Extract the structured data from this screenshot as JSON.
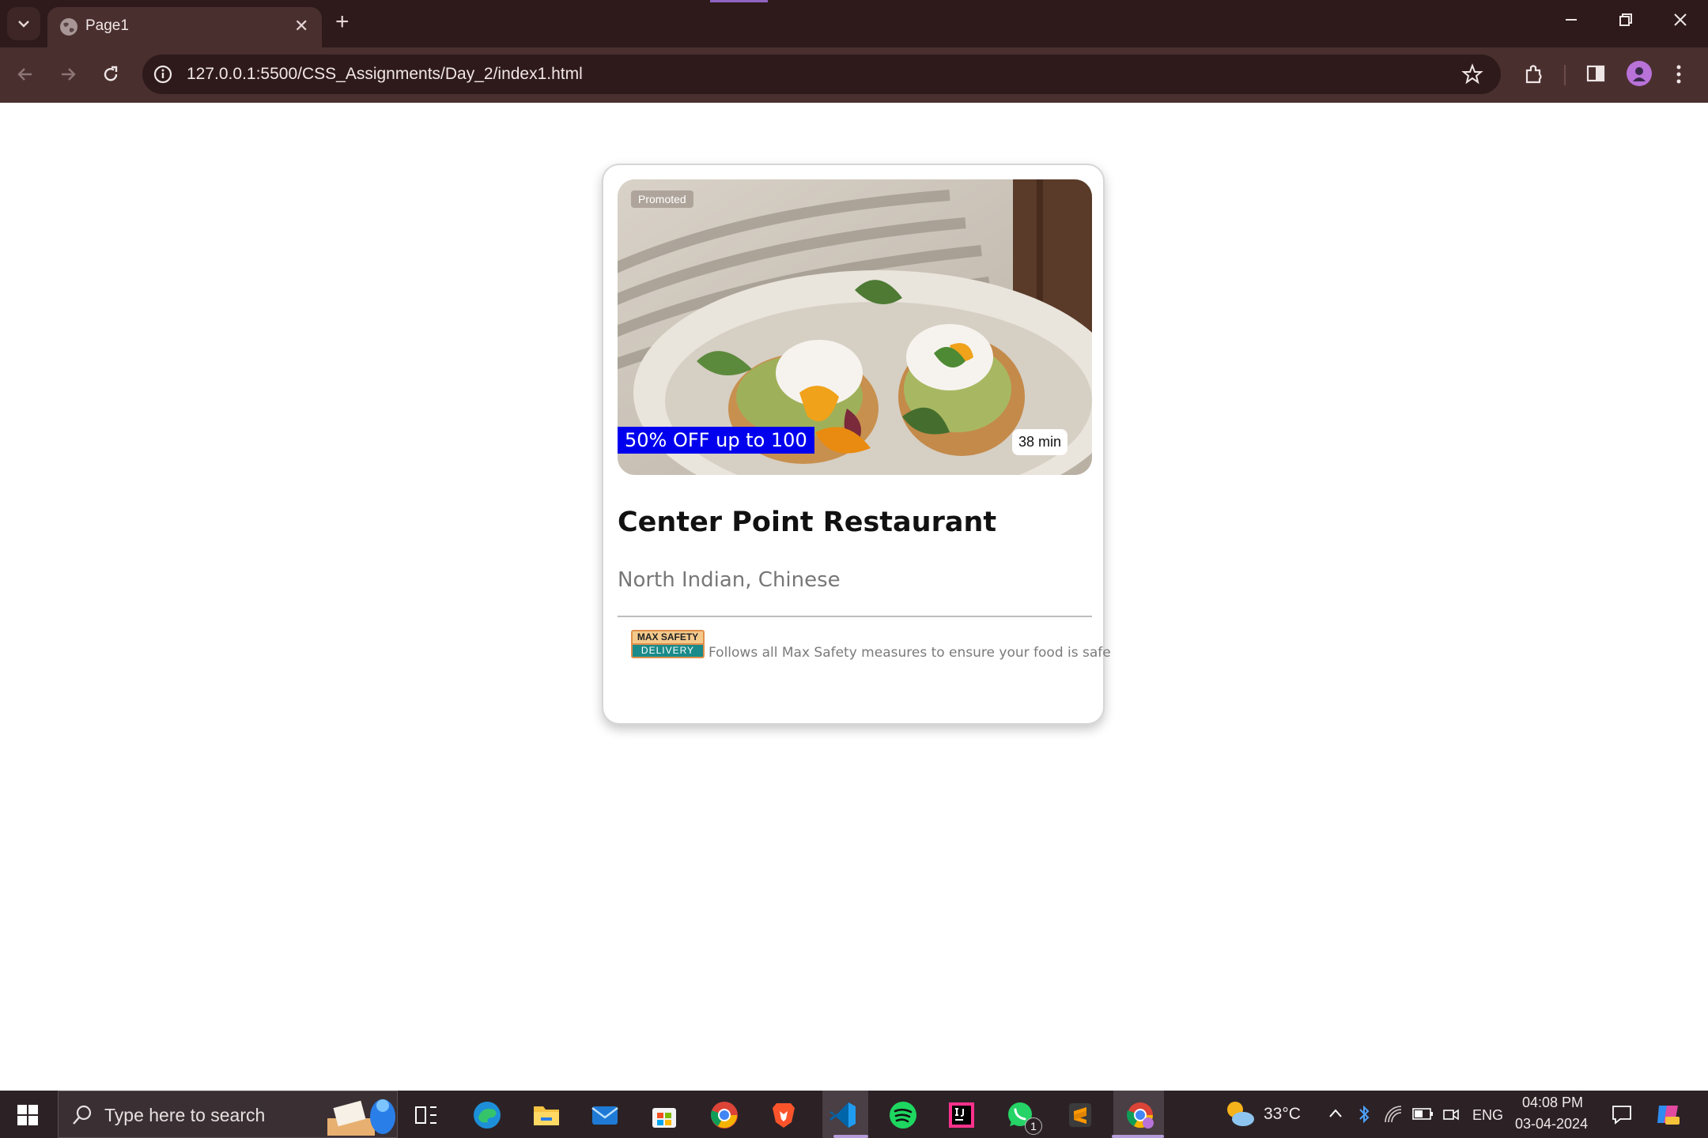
{
  "browser": {
    "tab_title": "Page1",
    "url": "127.0.0.1:5500/CSS_Assignments/Day_2/index1.html",
    "new_tab_label": "+",
    "close_tab_label": "✕"
  },
  "card": {
    "promoted_label": "Promoted",
    "offer_text": "50% OFF up to 100",
    "delivery_time": "38 min",
    "restaurant_name": "Center Point Restaurant",
    "cuisines": "North Indian, Chinese",
    "safety_badge_top": "MAX SAFETY",
    "safety_badge_bottom": "DELIVERY",
    "safety_text": "Follows all Max Safety measures to ensure your food is safe"
  },
  "taskbar": {
    "search_placeholder": "Type here to search",
    "weather_temp": "33°C",
    "language": "ENG",
    "time": "04:08 PM",
    "date": "03-04-2024",
    "whatsapp_badge": "1"
  },
  "colors": {
    "offer_bg": "#0000ee",
    "chrome_dark": "#2e1a1a",
    "chrome_toolbar": "#4a2f2f"
  }
}
